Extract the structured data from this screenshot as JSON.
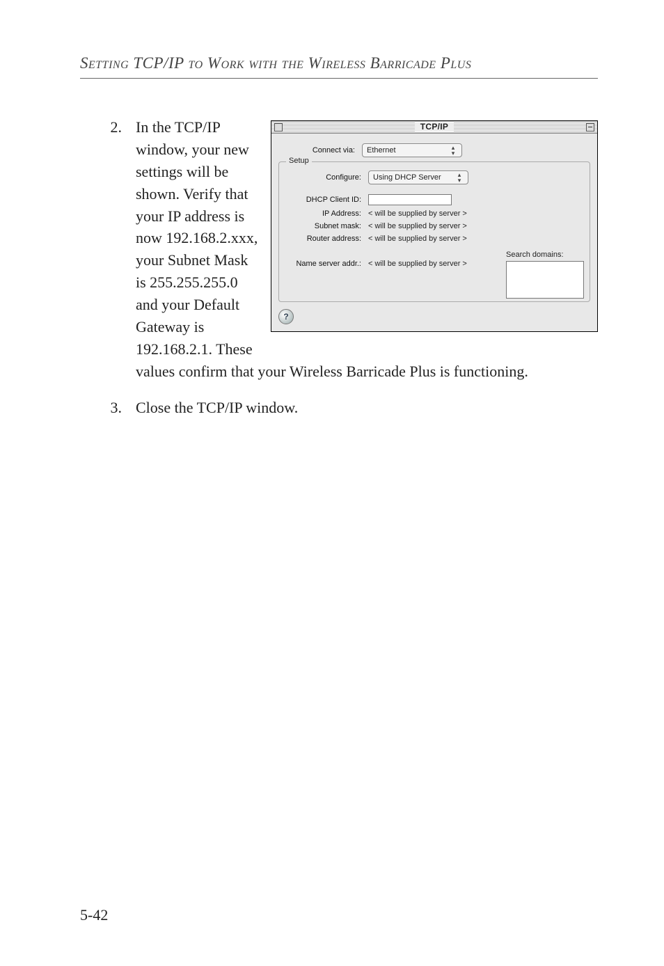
{
  "heading": "Setting TCP/IP to Work with the Wireless Barricade Plus",
  "items": [
    {
      "num": "2.",
      "text_part_a": "In the TCP/IP window, your new settings will be shown. Verify that your IP address is now 192.168.2.xxx, your Subnet Mask is 255.255.255.0 and your Default Gateway is 192.168.2.1. These",
      "text_part_b": "values confirm that your Wireless Barricade Plus is functioning."
    },
    {
      "num": "3.",
      "text": "Close the TCP/IP window."
    }
  ],
  "dialog": {
    "title": "TCP/IP",
    "connect_via_label": "Connect via:",
    "connect_via_value": "Ethernet",
    "setup_legend": "Setup",
    "configure_label": "Configure:",
    "configure_value": "Using DHCP Server",
    "dhcp_client_id_label": "DHCP Client ID:",
    "ip_address_label": "IP Address:",
    "ip_address_value": "< will be supplied by server >",
    "subnet_mask_label": "Subnet mask:",
    "subnet_mask_value": "< will be supplied by server >",
    "router_address_label": "Router address:",
    "router_address_value": "< will be supplied by server >",
    "name_server_addr_label": "Name server addr.:",
    "name_server_addr_value": "< will be supplied by server >",
    "search_domains_label": "Search domains:"
  },
  "page_number": "5-42"
}
